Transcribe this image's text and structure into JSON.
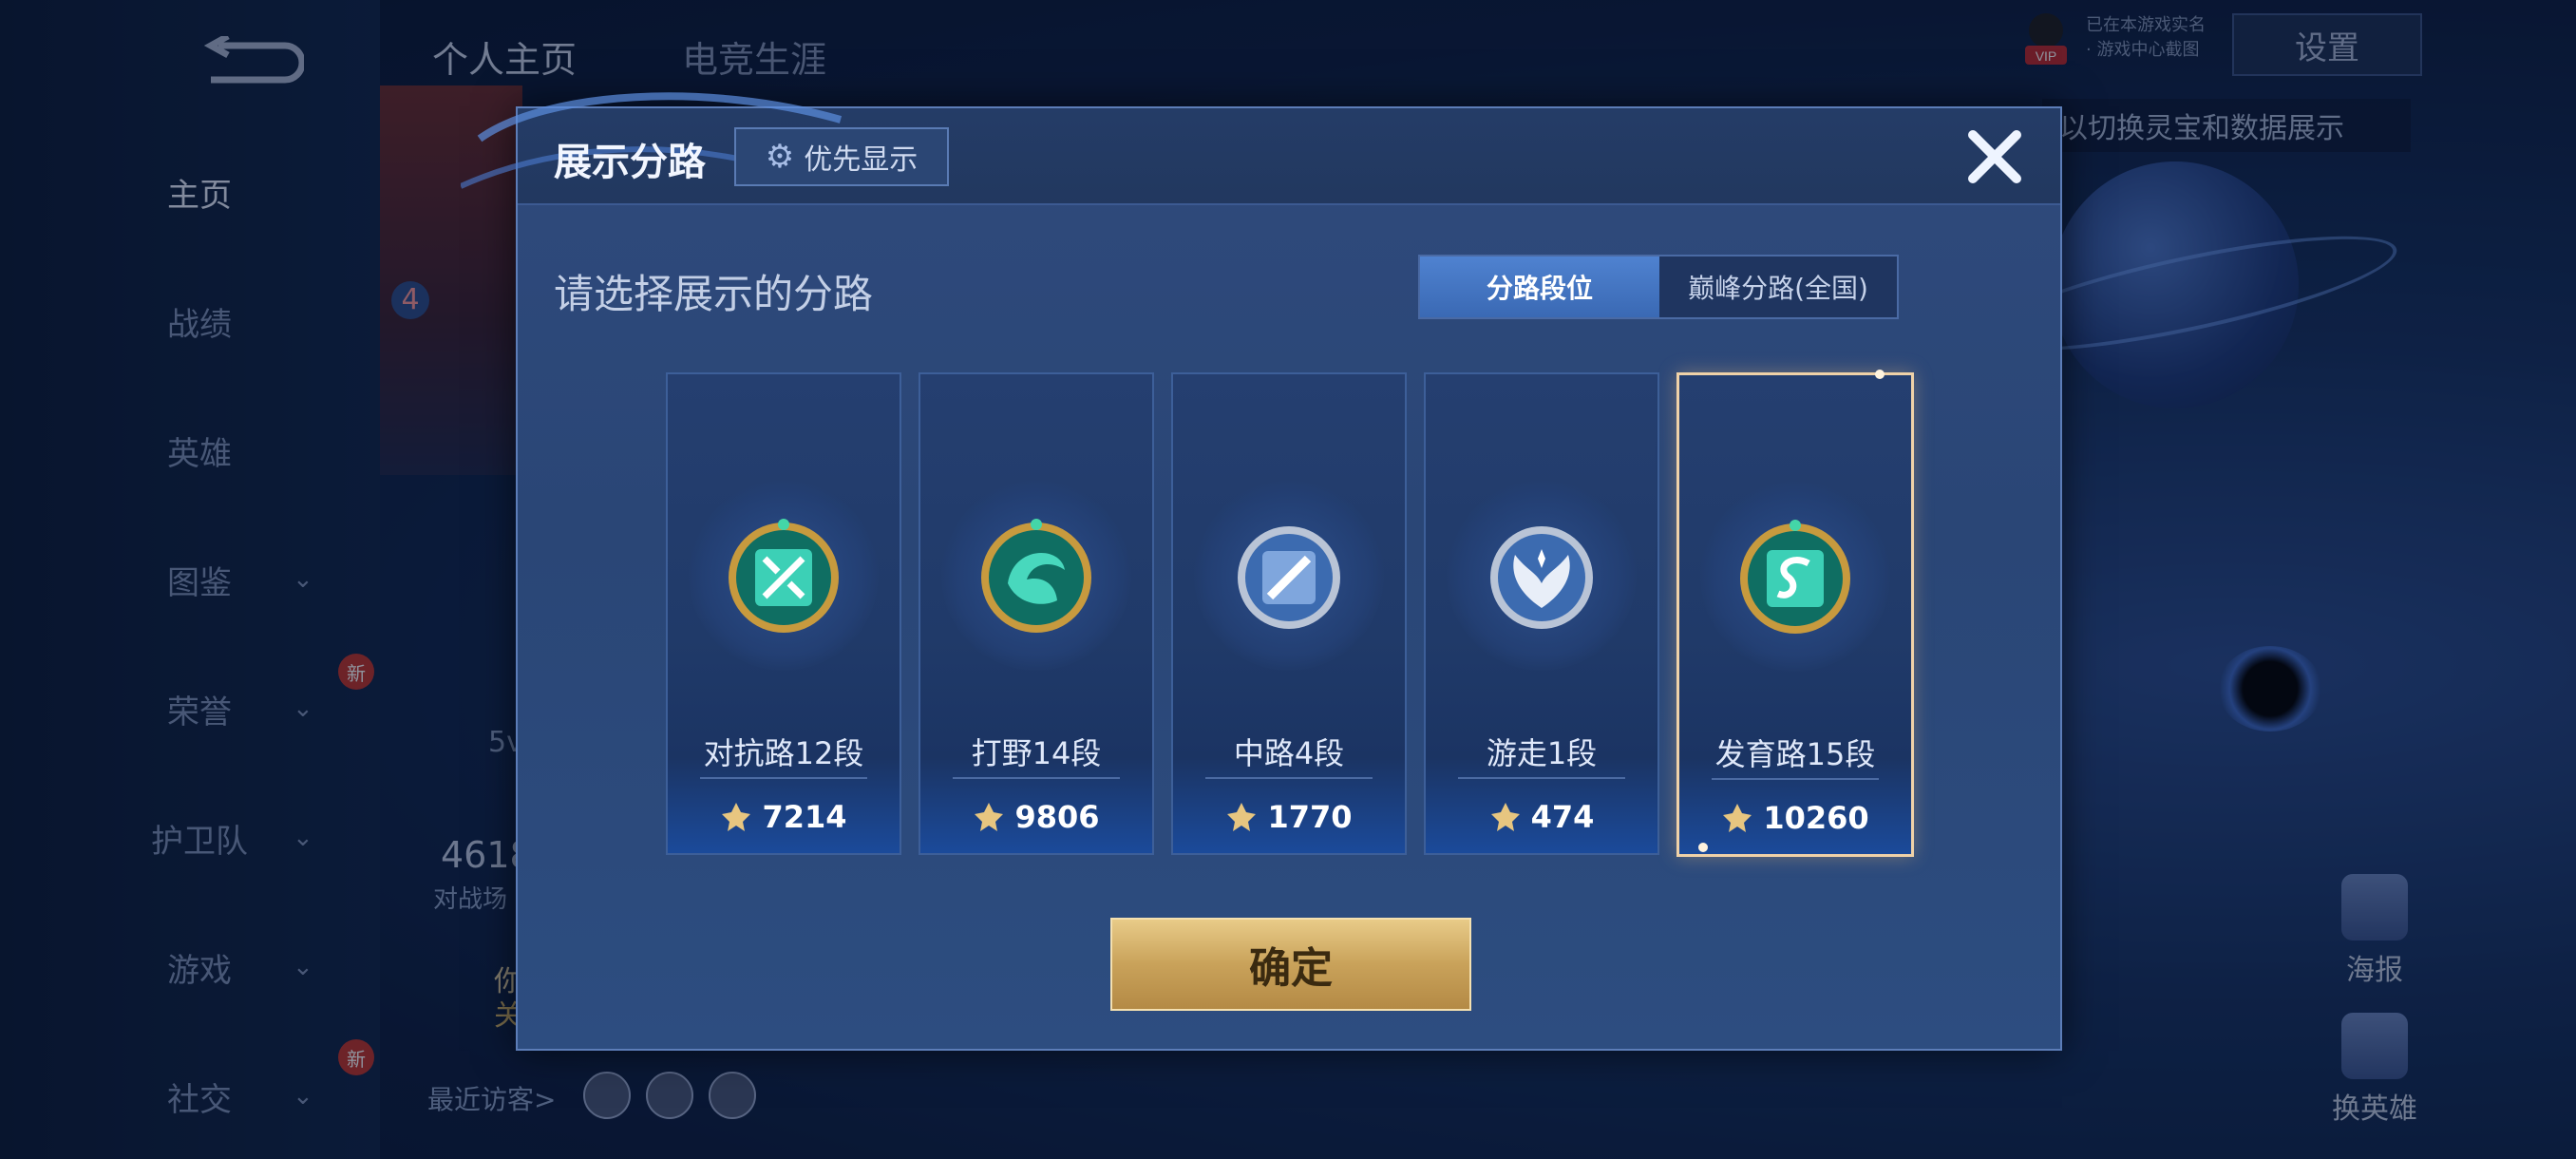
{
  "topbar": {
    "tabs": [
      "个人主页",
      "电竞生涯"
    ],
    "settings_label": "设置",
    "vip_label": "VIP",
    "vip_note_line1": "已在本游戏实名",
    "vip_note_line2": "· 游戏中心截图",
    "switch_hint": "以切换灵宝和数据展示"
  },
  "sidebar": {
    "items": [
      {
        "label": "主页"
      },
      {
        "label": "战绩"
      },
      {
        "label": "英雄"
      },
      {
        "label": "图鉴"
      },
      {
        "label": "荣誉"
      },
      {
        "label": "护卫队"
      },
      {
        "label": "游戏"
      },
      {
        "label": "社交"
      }
    ],
    "new_badge": "新"
  },
  "background": {
    "badge_number": "4",
    "mode_text": "5v",
    "stat_value": "4618",
    "stat_label": "对战场",
    "friend_text1": "你",
    "friend_text2": "关",
    "recent_visitors": "最近访客>"
  },
  "right_tools": {
    "poster": "海报",
    "swap_hero": "换英雄"
  },
  "dialog": {
    "title": "展示分路",
    "priority_label": "优先显示",
    "prompt": "请选择展示的分路",
    "tabs": [
      "分路段位",
      "巅峰分路(全国)"
    ],
    "lanes": [
      {
        "name": "对抗路12段",
        "score": "7214"
      },
      {
        "name": "打野14段",
        "score": "9806"
      },
      {
        "name": "中路4段",
        "score": "1770"
      },
      {
        "name": "游走1段",
        "score": "474"
      },
      {
        "name": "发育路15段",
        "score": "10260"
      }
    ],
    "confirm_label": "确定"
  }
}
